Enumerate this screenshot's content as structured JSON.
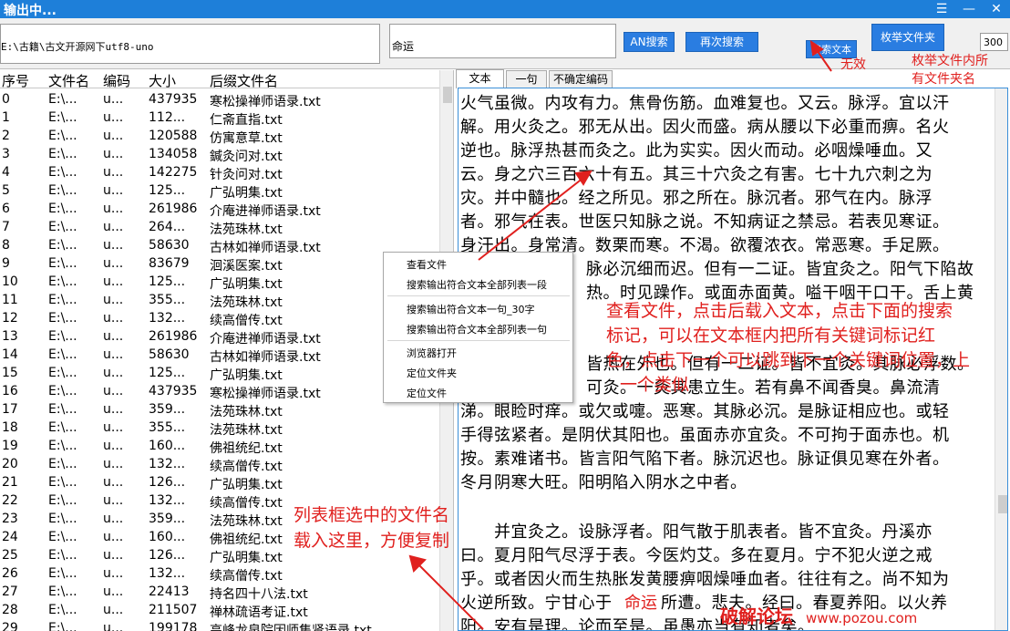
{
  "window": {
    "title": "输出中...",
    "menu_glyph": "☰",
    "min_glyph": "—",
    "close_glyph": "✕"
  },
  "toolbar": {
    "path_value": "E:\\古籍\\古文开源网下utf8-uno",
    "search_value": "命运",
    "an_search_label": "AN搜索",
    "search_again_label": "再次搜索",
    "search_text_label": "搜索文本",
    "enum_folder_label": "枚举文件夹",
    "count_value": "300",
    "anno_invalid": "无效",
    "anno_enum_line1": "枚举文件内所",
    "anno_enum_line2": "有文件夹名"
  },
  "list": {
    "headers": [
      "序号",
      "文件名",
      "编码",
      "大小",
      "后缀文件名"
    ],
    "rows": [
      {
        "n": "0",
        "f": "E:\\...",
        "e": "u...",
        "s": "437935",
        "x": "寒松操禅师语录.txt"
      },
      {
        "n": "1",
        "f": "E:\\...",
        "e": "u...",
        "s": "112...",
        "x": "仁斋直指.txt"
      },
      {
        "n": "2",
        "f": "E:\\...",
        "e": "u...",
        "s": "120588",
        "x": "仿寓意草.txt"
      },
      {
        "n": "3",
        "f": "E:\\...",
        "e": "u...",
        "s": "134058",
        "x": "鍼灸问对.txt"
      },
      {
        "n": "4",
        "f": "E:\\...",
        "e": "u...",
        "s": "142275",
        "x": "针灸问对.txt"
      },
      {
        "n": "5",
        "f": "E:\\...",
        "e": "u...",
        "s": "125...",
        "x": "广弘明集.txt"
      },
      {
        "n": "6",
        "f": "E:\\...",
        "e": "u...",
        "s": "261986",
        "x": "介庵进禅师语录.txt"
      },
      {
        "n": "7",
        "f": "E:\\...",
        "e": "u...",
        "s": "264...",
        "x": "法苑珠林.txt"
      },
      {
        "n": "8",
        "f": "E:\\...",
        "e": "u...",
        "s": "58630",
        "x": "古林如禅师语录.txt"
      },
      {
        "n": "9",
        "f": "E:\\...",
        "e": "u...",
        "s": "83679",
        "x": "洄溪医案.txt"
      },
      {
        "n": "10",
        "f": "E:\\...",
        "e": "u...",
        "s": "125...",
        "x": "广弘明集.txt"
      },
      {
        "n": "11",
        "f": "E:\\...",
        "e": "u...",
        "s": "355...",
        "x": "法苑珠林.txt"
      },
      {
        "n": "12",
        "f": "E:\\...",
        "e": "u...",
        "s": "132...",
        "x": "续高僧传.txt"
      },
      {
        "n": "13",
        "f": "E:\\...",
        "e": "u...",
        "s": "261986",
        "x": "介庵进禅师语录.txt"
      },
      {
        "n": "14",
        "f": "E:\\...",
        "e": "u...",
        "s": "58630",
        "x": "古林如禅师语录.txt"
      },
      {
        "n": "15",
        "f": "E:\\...",
        "e": "u...",
        "s": "125...",
        "x": "广弘明集.txt"
      },
      {
        "n": "16",
        "f": "E:\\...",
        "e": "u...",
        "s": "437935",
        "x": "寒松操禅师语录.txt"
      },
      {
        "n": "17",
        "f": "E:\\...",
        "e": "u...",
        "s": "359...",
        "x": "法苑珠林.txt"
      },
      {
        "n": "18",
        "f": "E:\\...",
        "e": "u...",
        "s": "355...",
        "x": "法苑珠林.txt"
      },
      {
        "n": "19",
        "f": "E:\\...",
        "e": "u...",
        "s": "160...",
        "x": "佛祖统纪.txt"
      },
      {
        "n": "20",
        "f": "E:\\...",
        "e": "u...",
        "s": "132...",
        "x": "续高僧传.txt"
      },
      {
        "n": "21",
        "f": "E:\\...",
        "e": "u...",
        "s": "126...",
        "x": "广弘明集.txt"
      },
      {
        "n": "22",
        "f": "E:\\...",
        "e": "u...",
        "s": "132...",
        "x": "续高僧传.txt"
      },
      {
        "n": "23",
        "f": "E:\\...",
        "e": "u...",
        "s": "359...",
        "x": "法苑珠林.txt"
      },
      {
        "n": "24",
        "f": "E:\\...",
        "e": "u...",
        "s": "160...",
        "x": "佛祖统纪.txt"
      },
      {
        "n": "25",
        "f": "E:\\...",
        "e": "u...",
        "s": "126...",
        "x": "广弘明集.txt"
      },
      {
        "n": "26",
        "f": "E:\\...",
        "e": "u...",
        "s": "132...",
        "x": "续高僧传.txt"
      },
      {
        "n": "27",
        "f": "E:\\...",
        "e": "u...",
        "s": "22413",
        "x": "持名四十八法.txt"
      },
      {
        "n": "28",
        "f": "E:\\...",
        "e": "u...",
        "s": "211507",
        "x": "禅林疏语考证.txt"
      },
      {
        "n": "29",
        "f": "E:\\...",
        "e": "u...",
        "s": "199178",
        "x": "高峰龙泉院因师集贤语录.txt"
      }
    ]
  },
  "context_menu": {
    "items": [
      "查看文件",
      "搜索输出符合文本全部列表一段",
      "搜索输出符合文本一句_30字",
      "搜索输出符合文本全部列表一句",
      "浏览器打开",
      "定位文件夹",
      "定位文件"
    ]
  },
  "tabs": [
    "文本",
    "一句",
    "不确定编码"
  ],
  "text_lines": [
    "火气虽微。内攻有力。焦骨伤筋。血难复也。又云。脉浮。宜以汗",
    "解。用火灸之。邪无从出。因火而盛。病从腰以下必重而痹。名火",
    "逆也。脉浮热甚而灸之。此为实实。因火而动。必咽燥唾血。又",
    "云。身之穴三百六十有五。其三十穴灸之有害。七十九穴刺之为",
    "灾。并中髓也。经之所见。邪之所在。脉沉者。邪气在内。脉浮",
    "者。邪气在表。世医只知脉之说。不知病证之禁忌。若表见寒证。",
    "身汗出。身常清。数栗而寒。不渴。欲覆浓衣。常恶寒。手足厥。",
    "脉必沉细而迟。但有一二证。皆宜灸之。阳气下陷故",
    "热。时见躁作。或面赤面黄。嗌干咽干口干。舌上黄"
  ],
  "text_lines_2": [
    "皆热在外也。但有一二证。皆不宜灸。其脉必浮数。",
    "可灸。一灸其患立生。若有鼻不闻香臭。鼻流清",
    "涕。眼睑时痒。或欠或嚏。恶寒。其脉必沉。是脉证相应也。或轻",
    "手得弦紧者。是阴伏其阳也。虽面赤亦宜灸。不可拘于面赤也。机",
    "按。素难诸书。皆言阳气陷下者。脉沉迟也。脉证俱见寒在外者。",
    "冬月阴寒大旺。阳明陷入阴水之中者。"
  ],
  "text_lines_3": [
    "　　并宜灸之。设脉浮者。阳气散于肌表者。皆不宜灸。丹溪亦",
    "曰。夏月阳气尽浮于表。今医灼艾。多在夏月。宁不犯火逆之戒",
    "乎。或者因火而生热胀发黄腰痹咽燥唾血者。往往有之。尚不知为",
    "火逆所致。宁甘心于",
    "所遭。悲夫。经曰。春夏养阳。以火养",
    "阳。安有是理。论而至是。虽愚亦当有知者矣。"
  ],
  "highlight_word": "命运",
  "overlay": {
    "viewfile_line1": "查看文件，点击后载入文本，点击下面的搜索",
    "viewfile_line2": "标记，可以在文本框内把所有关键词标记红",
    "viewfile_line3": "色，点击下一个可以跳到下一个关键词位置，上",
    "viewfile_line4": "一个类似",
    "list_line1": "列表框选中的文件名",
    "list_line2": "载入这里，方便复制"
  },
  "watermark": {
    "text": "破解论坛",
    "url": "www.pozou.com"
  },
  "colors": {
    "accent": "#1e7fd9",
    "annotation": "#e0201e"
  }
}
